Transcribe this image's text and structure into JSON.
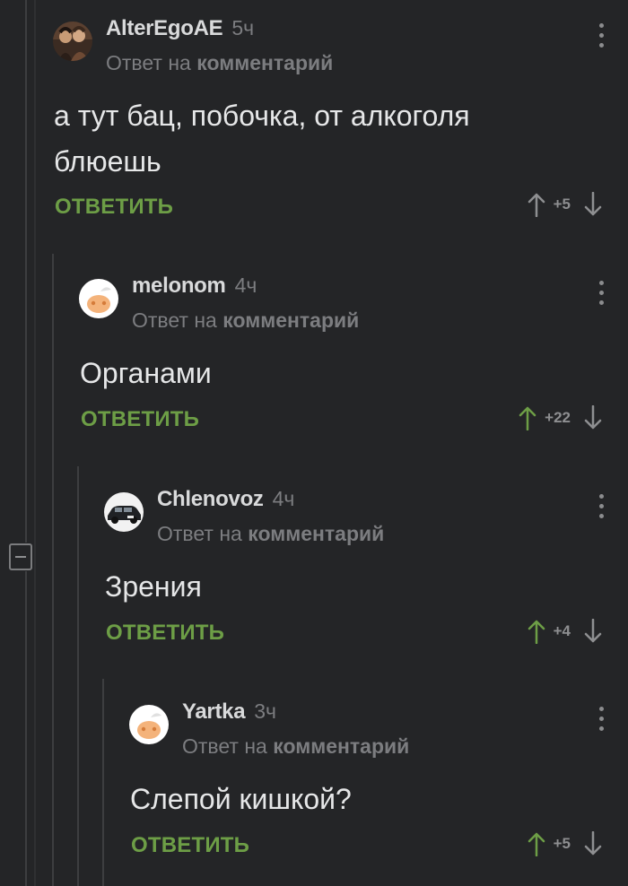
{
  "comments": [
    {
      "author": "AlterEgoAE",
      "time": "5ч",
      "reply_prefix": "Ответ на",
      "reply_link": "комментарий",
      "text_lines": [
        "а тут бац, побочка, от алкоголя",
        "блюешь"
      ],
      "reply_label": "ОТВЕТИТЬ",
      "score": "+5",
      "avatar": "photo-avatar",
      "upvoted": false
    },
    {
      "author": "melonom",
      "time": "4ч",
      "reply_prefix": "Ответ на",
      "reply_link": "комментарий",
      "text_lines": [
        "Органами"
      ],
      "reply_label": "ОТВЕТИТЬ",
      "score": "+22",
      "avatar": "default-avatar",
      "upvoted": true
    },
    {
      "author": "Chlenovoz",
      "time": "4ч",
      "reply_prefix": "Ответ на",
      "reply_link": "комментарий",
      "text_lines": [
        "Зрения"
      ],
      "reply_label": "ОТВЕТИТЬ",
      "score": "+4",
      "avatar": "car-avatar",
      "upvoted": true
    },
    {
      "author": "Yartka",
      "time": "3ч",
      "reply_prefix": "Ответ на",
      "reply_link": "комментарий",
      "text_lines": [
        "Слепой кишкой?"
      ],
      "reply_label": "ОТВЕТИТЬ",
      "score": "+5",
      "avatar": "default-avatar",
      "upvoted": true
    }
  ],
  "colors": {
    "background": "#242527",
    "accent_green": "#6d9e46",
    "author_text": "#d9dadb",
    "muted_text": "#7c7d80"
  }
}
